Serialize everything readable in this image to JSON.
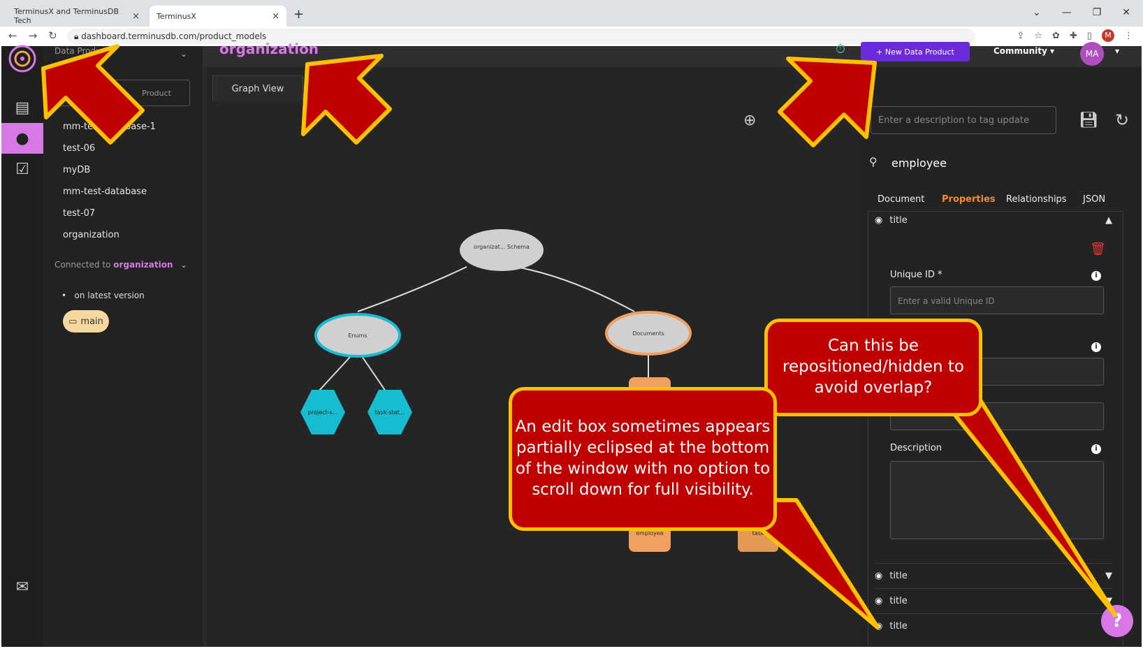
{
  "browser": {
    "tabs": [
      {
        "label": "TerminusX and TerminusDB Tech",
        "close": "×"
      },
      {
        "label": "TerminusX",
        "close": "×"
      }
    ],
    "new_tab": "+",
    "url": "dashboard.terminusdb.com/product_models"
  },
  "header": {
    "page_title": "organization",
    "new_product_label": "+ New Data Product",
    "community_label": "Community",
    "user_initials": "MA"
  },
  "sidebar": {
    "section_title": "Data Products",
    "new_product_label": "Product",
    "products": [
      "mm-test-database-1",
      "test-06",
      "myDB",
      "mm-test-database",
      "test-07",
      "organization"
    ],
    "connected_prefix": "Connected to ",
    "connected_name": "organization",
    "version_label": "on latest version",
    "branch_label": "main"
  },
  "graph": {
    "tab_label": "Graph View",
    "root_label": "organizat... Schema",
    "enums_label": "Enums",
    "documents_label": "Documents",
    "enum_children": [
      "project-s...",
      "task-stat..."
    ],
    "document_children": [
      "employee",
      "task"
    ]
  },
  "panel": {
    "description_placeholder": "Enter a description to tag update",
    "class_name": "employee",
    "tabs": [
      "Document",
      "Properties",
      "Relationships",
      "JSON"
    ],
    "active_tab": "Properties",
    "expanded_property": "title",
    "unique_id_label": "Unique ID *",
    "unique_id_placeholder": "Enter a valid Unique ID",
    "description_label": "Description",
    "collapsed_properties": [
      "title",
      "title",
      "title"
    ]
  },
  "callouts": {
    "left_text": "An edit box sometimes appears partially eclipsed at the bottom of the window with no option to scroll down for full visibility.",
    "right_text": "Can this be repositioned/hidden to avoid overlap?"
  },
  "help_label": "?",
  "colors": {
    "accent": "#d877e6",
    "callout_fill": "#c00000",
    "callout_border": "#ffc000",
    "enum_node": "#17bcd0",
    "document_node": "#f0a060"
  }
}
